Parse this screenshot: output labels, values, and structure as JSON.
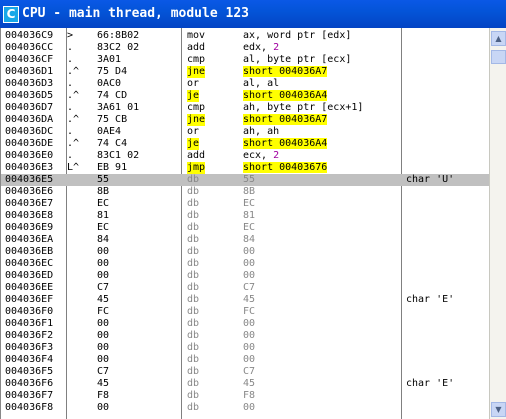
{
  "window": {
    "title": "CPU - main thread, module 123",
    "icon_label": "C"
  },
  "rows": [
    {
      "addr": "004036C9",
      "mark": ">",
      "hex": "66:8B02",
      "mnem": "mov",
      "args": "ax, word ptr [edx]",
      "cmt": ""
    },
    {
      "addr": "004036CC",
      "mark": ".",
      "hex": "83C2 02",
      "mnem": "add",
      "args": "edx, ",
      "num": "2",
      "cmt": ""
    },
    {
      "addr": "004036CF",
      "mark": ".",
      "hex": "3A01",
      "mnem": "cmp",
      "args": "al, byte ptr [ecx]",
      "cmt": ""
    },
    {
      "addr": "004036D1",
      "mark": ".^",
      "hex": "75 D4",
      "mnem": "jne",
      "args": "short 004036A7",
      "jump": true,
      "cmt": ""
    },
    {
      "addr": "004036D3",
      "mark": ".",
      "hex": "0AC0",
      "mnem": "or",
      "args": "al, al",
      "cmt": ""
    },
    {
      "addr": "004036D5",
      "mark": ".^",
      "hex": "74 CD",
      "mnem": "je",
      "args": "short 004036A4",
      "jump": true,
      "cmt": ""
    },
    {
      "addr": "004036D7",
      "mark": ".",
      "hex": "3A61 01",
      "mnem": "cmp",
      "args": "ah, byte ptr [ecx+1]",
      "cmt": ""
    },
    {
      "addr": "004036DA",
      "mark": ".^",
      "hex": "75 CB",
      "mnem": "jne",
      "args": "short 004036A7",
      "jump": true,
      "cmt": ""
    },
    {
      "addr": "004036DC",
      "mark": ".",
      "hex": "0AE4",
      "mnem": "or",
      "args": "ah, ah",
      "cmt": ""
    },
    {
      "addr": "004036DE",
      "mark": ".^",
      "hex": "74 C4",
      "mnem": "je",
      "args": "short 004036A4",
      "jump": true,
      "cmt": ""
    },
    {
      "addr": "004036E0",
      "mark": ".",
      "hex": "83C1 02",
      "mnem": "add",
      "args": "ecx, ",
      "num": "2",
      "cmt": ""
    },
    {
      "addr": "004036E3",
      "mark": "L^",
      "hex": "EB 91",
      "mnem": "jmp",
      "args": "short 00403676",
      "jump": true,
      "cmt": ""
    },
    {
      "addr": "004036E5",
      "mark": "",
      "hex": "55",
      "mnem": "db",
      "args": "55",
      "data": true,
      "selected": true,
      "cmt": "char 'U'"
    },
    {
      "addr": "004036E6",
      "mark": "",
      "hex": "8B",
      "mnem": "db",
      "args": "8B",
      "data": true,
      "cmt": ""
    },
    {
      "addr": "004036E7",
      "mark": "",
      "hex": "EC",
      "mnem": "db",
      "args": "EC",
      "data": true,
      "cmt": ""
    },
    {
      "addr": "004036E8",
      "mark": "",
      "hex": "81",
      "mnem": "db",
      "args": "81",
      "data": true,
      "cmt": ""
    },
    {
      "addr": "004036E9",
      "mark": "",
      "hex": "EC",
      "mnem": "db",
      "args": "EC",
      "data": true,
      "cmt": ""
    },
    {
      "addr": "004036EA",
      "mark": "",
      "hex": "84",
      "mnem": "db",
      "args": "84",
      "data": true,
      "cmt": ""
    },
    {
      "addr": "004036EB",
      "mark": "",
      "hex": "00",
      "mnem": "db",
      "args": "00",
      "data": true,
      "cmt": ""
    },
    {
      "addr": "004036EC",
      "mark": "",
      "hex": "00",
      "mnem": "db",
      "args": "00",
      "data": true,
      "cmt": ""
    },
    {
      "addr": "004036ED",
      "mark": "",
      "hex": "00",
      "mnem": "db",
      "args": "00",
      "data": true,
      "cmt": ""
    },
    {
      "addr": "004036EE",
      "mark": "",
      "hex": "C7",
      "mnem": "db",
      "args": "C7",
      "data": true,
      "cmt": ""
    },
    {
      "addr": "004036EF",
      "mark": "",
      "hex": "45",
      "mnem": "db",
      "args": "45",
      "data": true,
      "cmt": "char 'E'"
    },
    {
      "addr": "004036F0",
      "mark": "",
      "hex": "FC",
      "mnem": "db",
      "args": "FC",
      "data": true,
      "cmt": ""
    },
    {
      "addr": "004036F1",
      "mark": "",
      "hex": "00",
      "mnem": "db",
      "args": "00",
      "data": true,
      "cmt": ""
    },
    {
      "addr": "004036F2",
      "mark": "",
      "hex": "00",
      "mnem": "db",
      "args": "00",
      "data": true,
      "cmt": ""
    },
    {
      "addr": "004036F3",
      "mark": "",
      "hex": "00",
      "mnem": "db",
      "args": "00",
      "data": true,
      "cmt": ""
    },
    {
      "addr": "004036F4",
      "mark": "",
      "hex": "00",
      "mnem": "db",
      "args": "00",
      "data": true,
      "cmt": ""
    },
    {
      "addr": "004036F5",
      "mark": "",
      "hex": "C7",
      "mnem": "db",
      "args": "C7",
      "data": true,
      "cmt": ""
    },
    {
      "addr": "004036F6",
      "mark": "",
      "hex": "45",
      "mnem": "db",
      "args": "45",
      "data": true,
      "cmt": "char 'E'"
    },
    {
      "addr": "004036F7",
      "mark": "",
      "hex": "F8",
      "mnem": "db",
      "args": "F8",
      "data": true,
      "cmt": ""
    },
    {
      "addr": "004036F8",
      "mark": "",
      "hex": "00",
      "mnem": "db",
      "args": "00",
      "data": true,
      "cmt": ""
    }
  ],
  "scrollbar": {
    "up_icon": "scroll-up-arrow",
    "down_icon": "scroll-down-arrow"
  },
  "colors": {
    "titlebar": "#0454d8",
    "jump_highlight": "#ffff00",
    "selection": "#c0c0c0",
    "immediate": "#a000a0"
  }
}
